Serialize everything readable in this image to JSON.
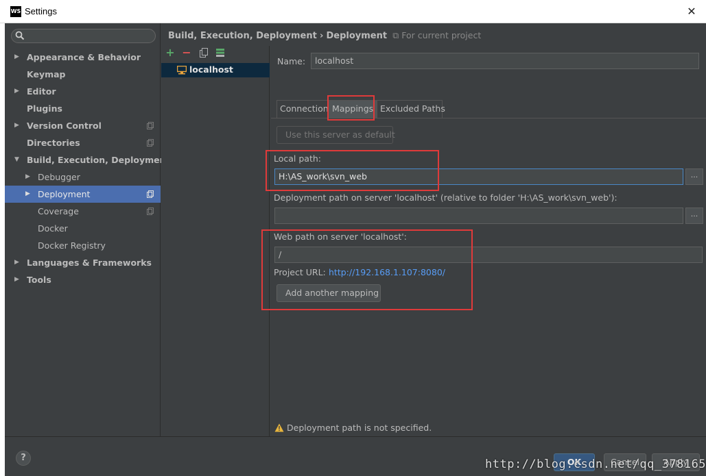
{
  "window": {
    "title": "Settings",
    "app_logo": "WS"
  },
  "sidebar": {
    "search": {
      "placeholder": ""
    },
    "items": [
      {
        "label": "Appearance & Behavior",
        "arrow": "▶"
      },
      {
        "label": "Keymap"
      },
      {
        "label": "Editor",
        "arrow": "▶"
      },
      {
        "label": "Plugins"
      },
      {
        "label": "Version Control",
        "arrow": "▶"
      },
      {
        "label": "Directories"
      },
      {
        "label": "Build, Execution, Deployment",
        "arrow": "▼"
      },
      {
        "label": "Debugger",
        "arrow": "▶"
      },
      {
        "label": "Deployment",
        "arrow": "▶"
      },
      {
        "label": "Coverage"
      },
      {
        "label": "Docker"
      },
      {
        "label": "Docker Registry"
      },
      {
        "label": "Languages & Frameworks",
        "arrow": "▶"
      },
      {
        "label": "Tools",
        "arrow": "▶"
      }
    ],
    "selected": "Deployment"
  },
  "breadcrumb": {
    "parent": "Build, Execution, Deployment",
    "separator": "›",
    "current": "Deployment",
    "scope": "For current project"
  },
  "servers": {
    "tools": [
      "add-icon",
      "remove-icon",
      "copy-icon",
      "default-icon"
    ],
    "items": [
      {
        "label": "localhost"
      }
    ]
  },
  "form": {
    "name_label": "Name:",
    "name_value": "localhost",
    "tabs": [
      "Connection",
      "Mappings",
      "Excluded Paths"
    ],
    "active_tab": "Mappings",
    "use_default_button": "Use this server as default",
    "local_path_label": "Local path:",
    "local_path_value": "H:\\AS_work\\svn_web",
    "browse_label": "...",
    "deployment_path_label": "Deployment path on server 'localhost' (relative to folder 'H:\\AS_work\\svn_web'):",
    "deployment_path_value": "",
    "web_path_label": "Web path on server 'localhost':",
    "web_path_value": "/",
    "project_url_label": "Project URL:",
    "project_url_value": "http://192.168.1.107:8080/",
    "add_mapping_button": "Add another mapping"
  },
  "warning": {
    "text": "Deployment path is not specified."
  },
  "footer": {
    "help_label": "?",
    "ok_label": "OK",
    "cancel_label": "Cancel",
    "apply_label": "Apply",
    "watermark": "http://blog.csdn.net/qq_37816525"
  },
  "colors": {
    "background": "#3c3f41",
    "selection": "#4b6eaf",
    "link": "#589df6",
    "highlight_box": "#e03a3a",
    "focus_border": "#4a88c7"
  }
}
